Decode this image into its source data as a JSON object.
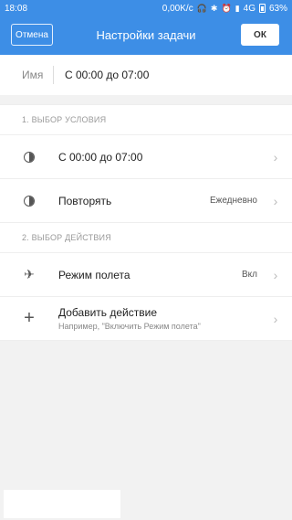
{
  "status_bar": {
    "time": "18:08",
    "speed": "0,00K/с",
    "network": "4G",
    "battery": "63%"
  },
  "header": {
    "cancel_label": "Отмена",
    "title": "Настройки задачи",
    "ok_label": "ОК"
  },
  "name_field": {
    "label": "Имя",
    "value": "С 00:00 до 07:00"
  },
  "section1": {
    "header": "1. ВЫБОР УСЛОВИЯ",
    "items": [
      {
        "icon": "moon-icon",
        "label": "С 00:00 до 07:00",
        "value": ""
      },
      {
        "icon": "half-circle-icon",
        "label": "Повторять",
        "value": "Ежедневно"
      }
    ]
  },
  "section2": {
    "header": "2. ВЫБОР ДЕЙСТВИЯ",
    "items": [
      {
        "icon": "airplane-icon",
        "label": "Режим полета",
        "value": "Вкл"
      },
      {
        "icon": "plus-icon",
        "label": "Добавить действие",
        "sublabel": "Например, \"Включить Режим полета\""
      }
    ]
  },
  "colors": {
    "accent": "#3d8ee6",
    "background": "#f2f2f2"
  }
}
